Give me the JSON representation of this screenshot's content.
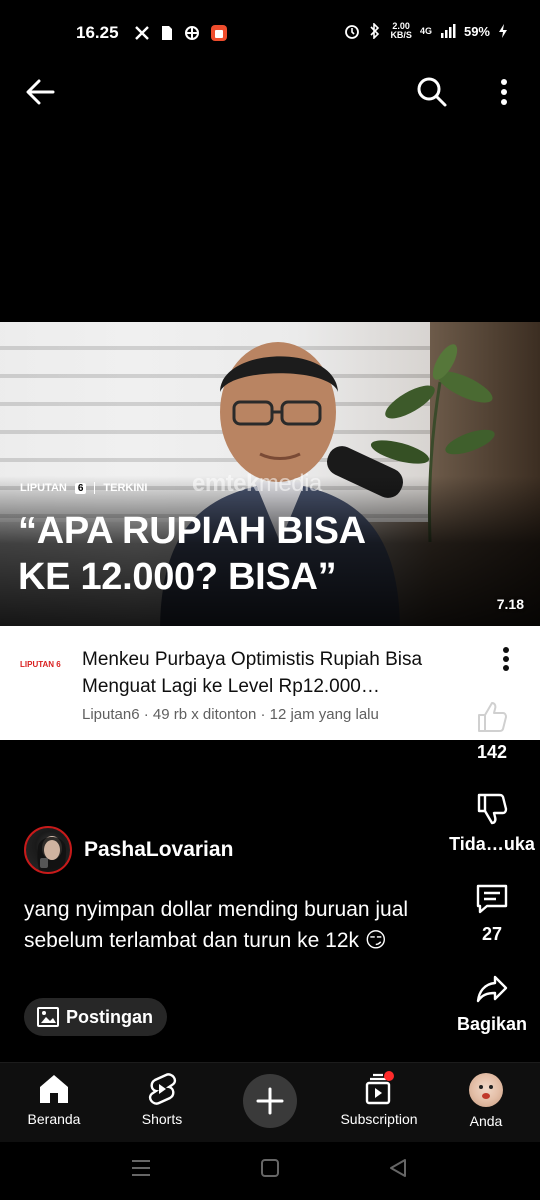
{
  "status_bar": {
    "time": "16.25",
    "net_speed_value": "2.00",
    "net_speed_unit": "KB/S",
    "network": "4G",
    "battery": "59%"
  },
  "top_bar": {
    "back_icon": "arrow-left-icon",
    "search_icon": "search-icon",
    "more_icon": "more-vert-icon"
  },
  "video": {
    "channel_tag": "LIPUTAN",
    "channel_tag_num": "6",
    "category": "TERKINI",
    "watermark_a": "emtek",
    "watermark_b": "media",
    "headline_line1": "“APA RUPIAH BISA",
    "headline_line2": "KE 12.000? BISA”",
    "duration": "7.18"
  },
  "card": {
    "logo": "LIPUTAN 6",
    "title": "Menkeu Purbaya Optimistis Rupiah Bisa Menguat Lagi ke Level Rp12.000…",
    "meta": "Liputan6 · 49 rb x ditonton · 12 jam yang lalu"
  },
  "actions": {
    "like_count": "142",
    "dislike_label": "Tida…uka",
    "comment_count": "27",
    "share_label": "Bagikan"
  },
  "post": {
    "channel_name": "PashaLovarian",
    "text": "yang nyimpan dollar mending buruan jual sebelum terlambat dan turun ke 12k 😏",
    "chip_label": "Postingan"
  },
  "bottom_nav": {
    "home": "Beranda",
    "shorts": "Shorts",
    "subscriptions": "Subscription",
    "you": "Anda"
  },
  "colors": {
    "background": "#000000",
    "card_bg": "#ffffff",
    "accent_red": "#ff2b2b",
    "nav_bg": "#0f0f0f"
  }
}
